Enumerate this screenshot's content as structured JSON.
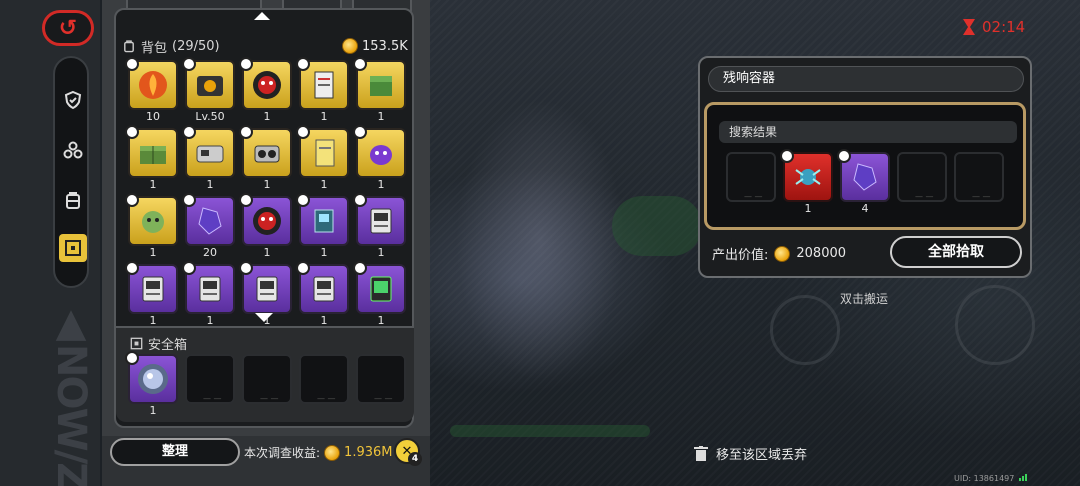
{
  "backpack": {
    "title": "背包",
    "capacity": "(29/50)",
    "currency": "153.5K",
    "rows": [
      [
        {
          "tier": "gold",
          "count": "10",
          "icon": "fire-orb-icon"
        },
        {
          "tier": "gold",
          "count": "Lv.50",
          "icon": "engine-icon"
        },
        {
          "tier": "gold",
          "count": "1",
          "icon": "red-mask-icon"
        },
        {
          "tier": "gold",
          "count": "1",
          "icon": "document-icon"
        },
        {
          "tier": "gold",
          "count": "1",
          "icon": "green-cube-icon"
        }
      ],
      [
        {
          "tier": "gold",
          "count": "1",
          "icon": "green-crate-icon"
        },
        {
          "tier": "gold",
          "count": "1",
          "icon": "device-icon"
        },
        {
          "tier": "gold",
          "count": "1",
          "icon": "binoculars-icon"
        },
        {
          "tier": "gold",
          "count": "1",
          "icon": "yellow-card-icon"
        },
        {
          "tier": "gold",
          "count": "1",
          "icon": "purple-creature-icon"
        }
      ],
      [
        {
          "tier": "gold",
          "count": "1",
          "icon": "green-creature-icon"
        },
        {
          "tier": "purple",
          "count": "20",
          "icon": "crystal-icon"
        },
        {
          "tier": "purple",
          "count": "1",
          "icon": "red-mask-icon"
        },
        {
          "tier": "purple",
          "count": "1",
          "icon": "chip-icon"
        },
        {
          "tier": "purple",
          "count": "1",
          "icon": "data-card-icon"
        }
      ],
      [
        {
          "tier": "purple",
          "count": "1",
          "icon": "data-card-icon"
        },
        {
          "tier": "purple",
          "count": "1",
          "icon": "data-card-icon"
        },
        {
          "tier": "purple",
          "count": "1",
          "icon": "data-card-icon"
        },
        {
          "tier": "purple",
          "count": "1",
          "icon": "data-card-icon"
        },
        {
          "tier": "purple",
          "count": "1",
          "icon": "green-card-icon"
        }
      ]
    ]
  },
  "safebox": {
    "title": "安全箱",
    "slots": [
      {
        "tier": "purple",
        "count": "1",
        "icon": "orb-icon"
      },
      {
        "tier": "empty",
        "count": "— —"
      },
      {
        "tier": "empty",
        "count": "— —"
      },
      {
        "tier": "empty",
        "count": "— —"
      },
      {
        "tier": "empty",
        "count": "— —"
      }
    ]
  },
  "bottom": {
    "sort_label": "整理",
    "earnings_label": "本次调查收益:",
    "earnings": "1.936M",
    "badge": "4"
  },
  "timer": "02:14",
  "container": {
    "title": "残响容器",
    "results_label": "搜索结果",
    "slots": [
      {
        "tier": "empty",
        "count": "— —"
      },
      {
        "tier": "red",
        "count": "1",
        "icon": "spider-mech-icon"
      },
      {
        "tier": "purple",
        "count": "4",
        "icon": "crystal-icon"
      },
      {
        "tier": "empty",
        "count": "— —"
      },
      {
        "tier": "empty",
        "count": "— —"
      }
    ],
    "output_label": "产出价值:",
    "output_value": "208000",
    "pick_all_label": "全部拾取"
  },
  "double_click_hint": "双击搬运",
  "discard_hint": "移至该区域丢弃",
  "uid": "UID: 13861497",
  "colors": {
    "gold": "#f5d660",
    "purple": "#8b54d6",
    "accent_red": "#e0302b",
    "coin": "#f0c43a"
  }
}
